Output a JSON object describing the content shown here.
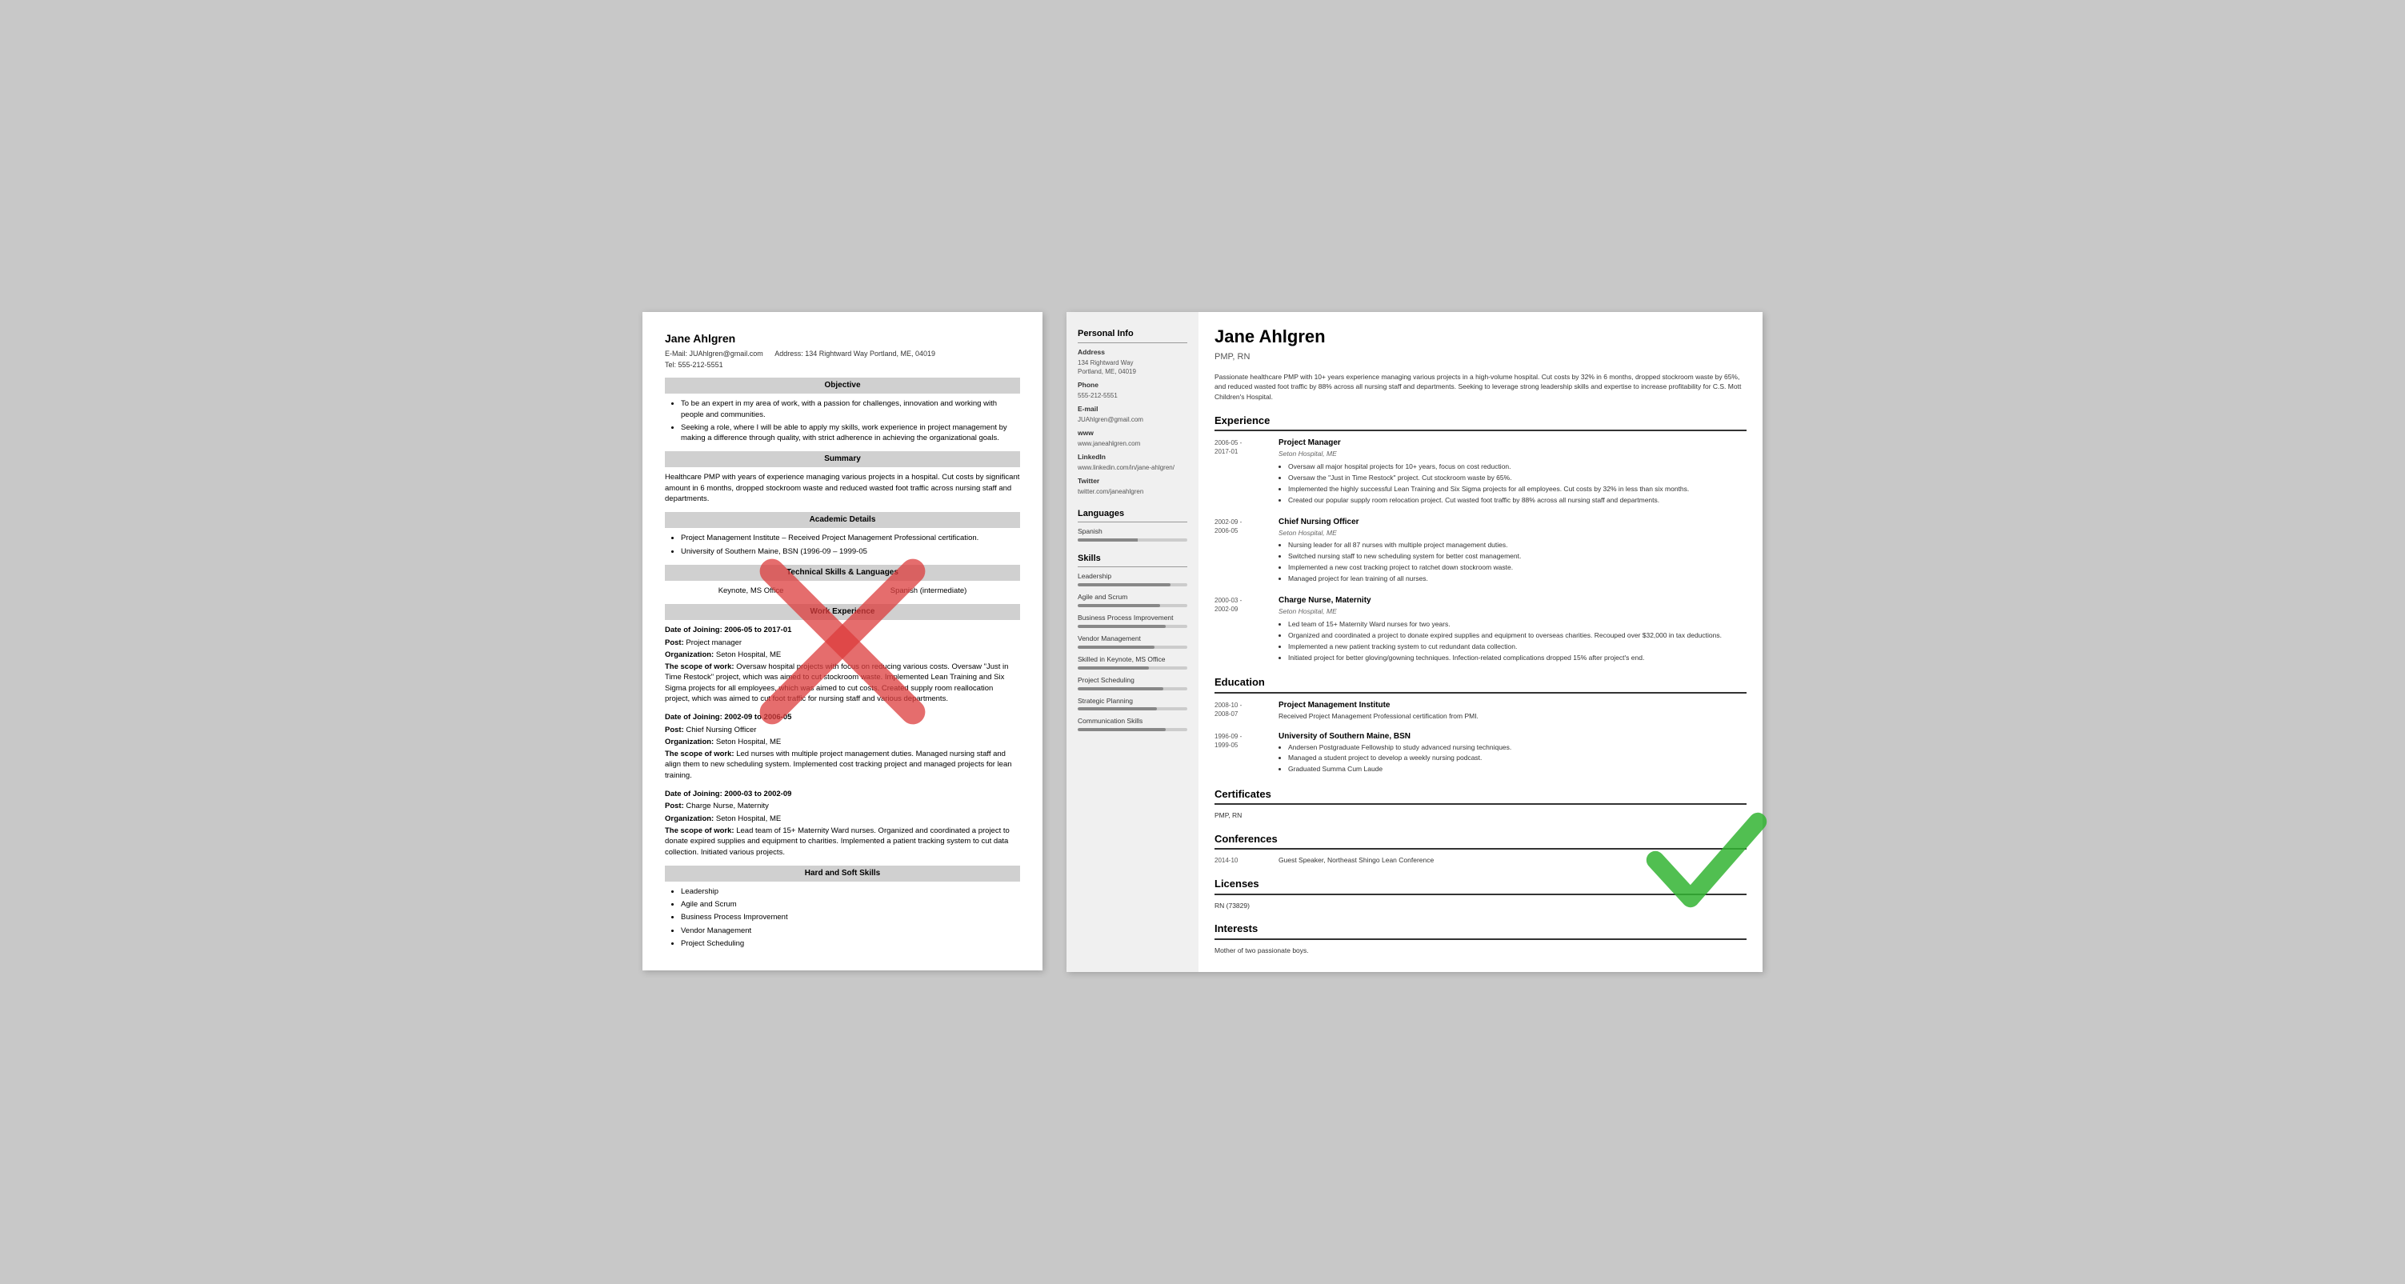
{
  "left_resume": {
    "name": "Jane Ahlgren",
    "email_label": "E-Mail:",
    "email": "JUAhlgren@gmail.com",
    "address_label": "Address:",
    "address": "134 Rightward Way Portland, ME, 04019",
    "tel_label": "Tel:",
    "tel": "555-212-5551",
    "sections": {
      "objective": {
        "title": "Objective",
        "bullets": [
          "To be an expert in my area of work, with a passion for challenges, innovation and working with people and communities.",
          "Seeking a role, where I will be able to apply my skills, work experience in project management by making a difference through quality, with strict adherence in achieving the organizational goals."
        ]
      },
      "summary": {
        "title": "Summary",
        "text": "Healthcare PMP with years of experience managing various projects in a hospital. Cut costs by significant amount in 6 months, dropped stockroom waste and reduced wasted foot traffic across nursing staff and departments."
      },
      "academic": {
        "title": "Academic Details",
        "bullets": [
          "Project Management Institute – Received Project Management Professional certification.",
          "University of Southern Maine, BSN (1996-09 – 1999-05"
        ]
      },
      "technical": {
        "title": "Technical Skills & Languages",
        "col1": "Keynote, MS Office",
        "col2": "Spanish (intermediate)"
      },
      "work": {
        "title": "Work Experience",
        "entries": [
          {
            "date_label": "Date of Joining:",
            "date": "2006-05 to 2017-01",
            "post_label": "Post:",
            "post": "Project manager",
            "org_label": "Organization:",
            "org": "Seton Hospital, ME",
            "scope_label": "The scope of work:",
            "scope": "Oversaw hospital projects with focus on reducing various costs. Oversaw \"Just in Time Restock\" project, which was aimed to cut stockroom waste. Implemented Lean Training and Six Sigma projects for all employees, which was aimed to cut costs. Created supply room reallocation project, which was aimed to cut foot traffic for nursing staff and various departments."
          },
          {
            "date_label": "Date of Joining:",
            "date": "2002-09 to 2006-05",
            "post_label": "Post:",
            "post": "Chief Nursing Officer",
            "org_label": "Organization:",
            "org": "Seton Hospital, ME",
            "scope_label": "The scope of work:",
            "scope": "Led nurses with multiple project management duties. Managed nursing staff and align them to new scheduling system. Implemented cost tracking project and managed projects for lean training."
          },
          {
            "date_label": "Date of Joining:",
            "date": "2000-03 to 2002-09",
            "post_label": "Post:",
            "post": "Charge Nurse, Maternity",
            "org_label": "Organization:",
            "org": "Seton Hospital, ME",
            "scope_label": "The scope of work:",
            "scope": "Lead team of 15+ Maternity Ward nurses. Organized and coordinated a project to donate expired supplies and equipment to charities. Implemented a patient tracking system to cut data collection. Initiated various projects."
          }
        ]
      },
      "hard_soft": {
        "title": "Hard and Soft Skills",
        "bullets": [
          "Leadership",
          "Agile and Scrum",
          "Business Process Improvement",
          "Vendor Management",
          "Project Scheduling"
        ]
      }
    }
  },
  "right_resume": {
    "name": "Jane Ahlgren",
    "title": "PMP, RN",
    "summary": "Passionate healthcare PMP with 10+ years experience managing various projects in a high-volume hospital. Cut costs by 32% in 6 months, dropped stockroom waste by 65%, and reduced wasted foot traffic by 88% across all nursing staff and departments. Seeking to leverage strong leadership skills and expertise to increase profitability for C.S. Mott Children's Hospital.",
    "sidebar": {
      "personal_info_title": "Personal Info",
      "address_label": "Address",
      "address": "134 Rightward Way\nPortland, ME, 04019",
      "phone_label": "Phone",
      "phone": "555-212-5551",
      "email_label": "E-mail",
      "email": "JUAhlgren@gmail.com",
      "www_label": "www",
      "www": "www.janeahlgren.com",
      "linkedin_label": "LinkedIn",
      "linkedin": "www.linkedin.com/in/jane-ahlgren/",
      "twitter_label": "Twitter",
      "twitter": "twitter.com/janeahlgren",
      "languages_title": "Languages",
      "languages": [
        {
          "name": "Spanish",
          "level": 55
        }
      ],
      "skills_title": "Skills",
      "skills": [
        {
          "name": "Leadership",
          "level": 85
        },
        {
          "name": "Agile and Scrum",
          "level": 75
        },
        {
          "name": "Business Process Improvement",
          "level": 80
        },
        {
          "name": "Vendor Management",
          "level": 70
        },
        {
          "name": "Skilled in Keynote, MS Office",
          "level": 65
        },
        {
          "name": "Project Scheduling",
          "level": 78
        },
        {
          "name": "Strategic Planning",
          "level": 72
        },
        {
          "name": "Communication Skills",
          "level": 80
        }
      ]
    },
    "main": {
      "experience_title": "Experience",
      "experiences": [
        {
          "date": "2006-05 -\n2017-01",
          "title": "Project Manager",
          "org": "Seton Hospital, ME",
          "bullets": [
            "Oversaw all major hospital projects for 10+ years, focus on cost reduction.",
            "Oversaw the \"Just in Time Restock\" project. Cut stockroom waste by 65%.",
            "Implemented the highly successful Lean Training and Six Sigma projects for all employees. Cut costs by 32% in less than six months.",
            "Created our popular supply room relocation project. Cut wasted foot traffic by 88% across all nursing staff and departments."
          ]
        },
        {
          "date": "2002-09 -\n2006-05",
          "title": "Chief Nursing Officer",
          "org": "Seton Hospital, ME",
          "bullets": [
            "Nursing leader for all 87 nurses with multiple project management duties.",
            "Switched nursing staff to new scheduling system for better cost management.",
            "Implemented a new cost tracking project to ratchet down stockroom waste.",
            "Managed project for lean training of all nurses."
          ]
        },
        {
          "date": "2000-03 -\n2002-09",
          "title": "Charge Nurse, Maternity",
          "org": "Seton Hospital, ME",
          "bullets": [
            "Led team of 15+ Maternity Ward nurses for two years.",
            "Organized and coordinated a project to donate expired supplies and equipment to overseas charities. Recouped over $32,000 in tax deductions.",
            "Implemented a new patient tracking system to cut redundant data collection.",
            "Initiated project for better gloving/gowning techniques. Infection-related complications dropped 15% after project's end."
          ]
        }
      ],
      "education_title": "Education",
      "education": [
        {
          "date": "2008-10 -\n2008-07",
          "school": "Project Management Institute",
          "detail": "Received Project Management Professional certification from PMI.",
          "bullets": []
        },
        {
          "date": "1996-09 -\n1999-05",
          "school": "University of Southern Maine, BSN",
          "detail": "",
          "bullets": [
            "Andersen Postgraduate Fellowship to study advanced nursing techniques.",
            "Managed a student project to develop a weekly nursing podcast.",
            "Graduated Summa Cum Laude"
          ]
        }
      ],
      "certificates_title": "Certificates",
      "certificates": [
        "PMP, RN"
      ],
      "conferences_title": "Conferences",
      "conferences": [
        {
          "date": "2014-10",
          "name": "Guest Speaker, Northeast Shingo Lean Conference"
        }
      ],
      "licenses_title": "Licenses",
      "licenses": [
        "RN (73829)"
      ],
      "interests_title": "Interests",
      "interests": [
        "Mother of two passionate boys."
      ]
    }
  }
}
